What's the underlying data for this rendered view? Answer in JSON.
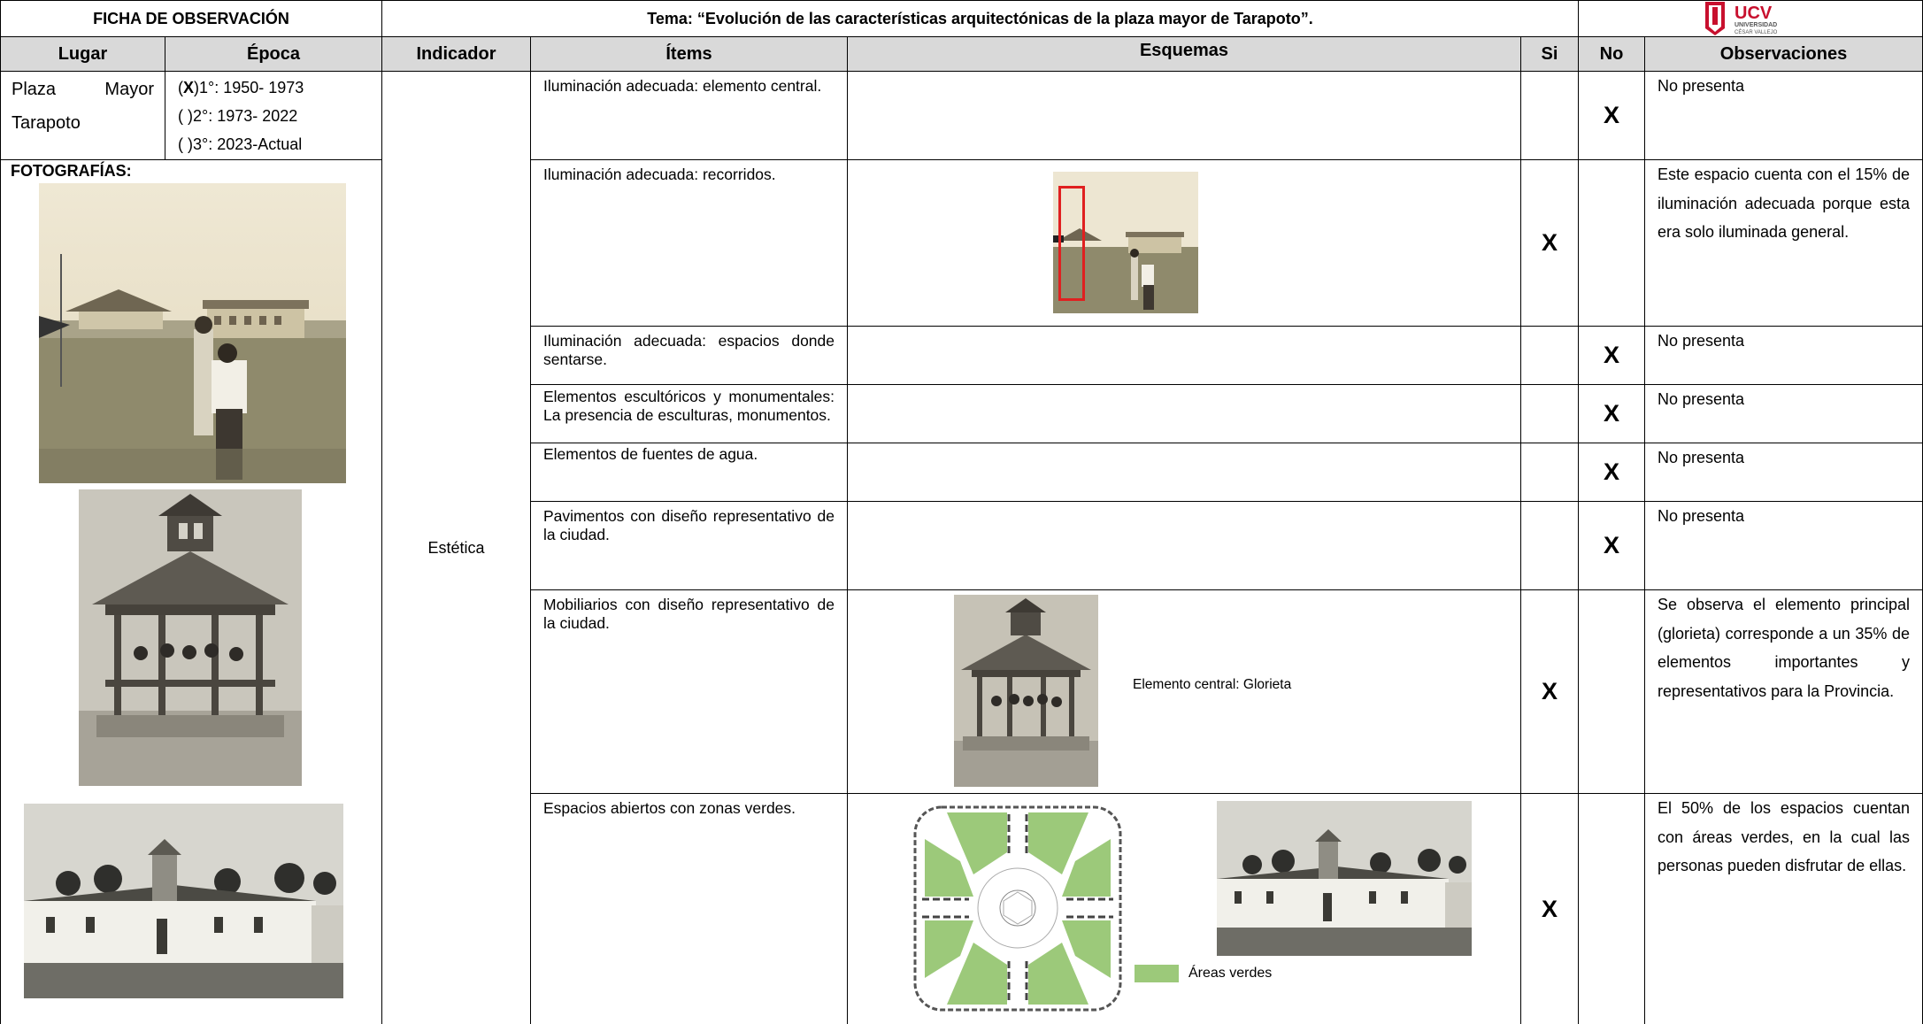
{
  "header": {
    "form_title": "FICHA DE OBSERVACIÓN",
    "topic": "Tema: “Evolución de las características arquitectónicas de la plaza mayor de Tarapoto”.",
    "logo": {
      "name": "UCV",
      "sub1": "UNIVERSIDAD",
      "sub2": "CÉSAR VALLEJO",
      "color": "#c8102e"
    }
  },
  "columns": {
    "lugar": "Lugar",
    "epoca": "Época",
    "indicador": "Indicador",
    "items": "Ítems",
    "esquemas": "Esquemas",
    "si": "Si",
    "no": "No",
    "observaciones": "Observaciones"
  },
  "lugar": {
    "line1a": "Plaza",
    "line1b": "Mayor",
    "line2": "Tarapoto"
  },
  "epoca": [
    {
      "mark": "X",
      "label": ")1°: 1950- 1973"
    },
    {
      "mark": " ",
      "label": ")2°: 1973- 2022"
    },
    {
      "mark": " ",
      "label": ")3°: 2023-Actual"
    }
  ],
  "photos_label": "FOTOGRAFÍAS:",
  "indicador": "Estética",
  "rows": [
    {
      "item": "Iluminación adecuada: elemento central.",
      "si": "",
      "no": "X",
      "obs": "No presenta"
    },
    {
      "item": "Iluminación adecuada: recorridos.",
      "si": "X",
      "no": "",
      "obs": "Este espacio cuenta con el 15% de iluminación adecuada porque esta era solo iluminada general."
    },
    {
      "item": "Iluminación adecuada: espacios donde sentarse.",
      "si": "",
      "no": "X",
      "obs": "No presenta"
    },
    {
      "item": "Elementos escultóricos y monumentales: La presencia de esculturas, monumentos.",
      "si": "",
      "no": "X",
      "obs": "No presenta"
    },
    {
      "item": "Elementos de fuentes de agua.",
      "si": "",
      "no": "X",
      "obs": "No presenta"
    },
    {
      "item": "Pavimentos con diseño representativo de la ciudad.",
      "si": "",
      "no": "X",
      "obs": "No presenta"
    },
    {
      "item": "Mobiliarios con diseño representativo de la ciudad.",
      "si": "X",
      "no": "",
      "obs": "Se observa el elemento principal (glorieta) corresponde a un 35% de elementos importantes y representativos para la Provincia."
    },
    {
      "item": "Espacios abiertos con zonas verdes.",
      "si": "X",
      "no": "",
      "obs": "El 50% de los espacios cuentan con áreas verdes, en la cual las personas pueden disfrutar de ellas."
    }
  ],
  "schemes": {
    "glorieta_caption": "Elemento central: Glorieta",
    "areas_legend": "Áreas verdes",
    "green": "#9cc97a",
    "highlight": "#e02020"
  }
}
